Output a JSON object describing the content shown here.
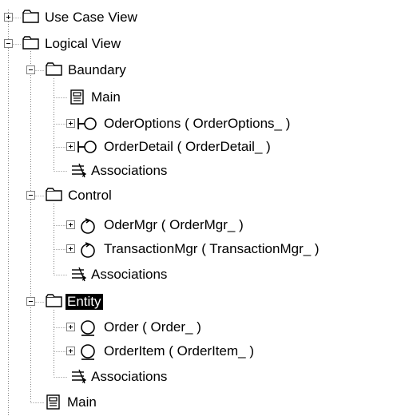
{
  "tree": {
    "use_case_view": {
      "label": "Use Case View",
      "expanded": false
    },
    "logical_view": {
      "label": "Logical View",
      "expanded": true
    },
    "baundary": {
      "label": "Baundary",
      "expanded": true,
      "main": "Main",
      "oder_options": "OderOptions ( OrderOptions_ )",
      "order_detail": "OrderDetail ( OrderDetail_ )",
      "associations": "Associations"
    },
    "control": {
      "label": "Control",
      "expanded": true,
      "oder_mgr": "OderMgr ( OrderMgr_ )",
      "transaction_mgr": "TransactionMgr ( TransactionMgr_ )",
      "associations": "Associations"
    },
    "entity": {
      "label": "Entity",
      "expanded": true,
      "selected": true,
      "order": "Order ( Order_ )",
      "order_item": "OrderItem ( OrderItem_ )",
      "associations": "Associations"
    },
    "main": "Main"
  },
  "icons": {
    "folder": "folder-icon",
    "diagram": "class-diagram-icon",
    "boundary": "boundary-class-icon",
    "control": "control-class-icon",
    "entity": "entity-class-icon",
    "associations": "associations-icon"
  },
  "colors": {
    "selection_bg": "#000000",
    "selection_fg": "#ffffff",
    "tree_line": "#808080"
  }
}
